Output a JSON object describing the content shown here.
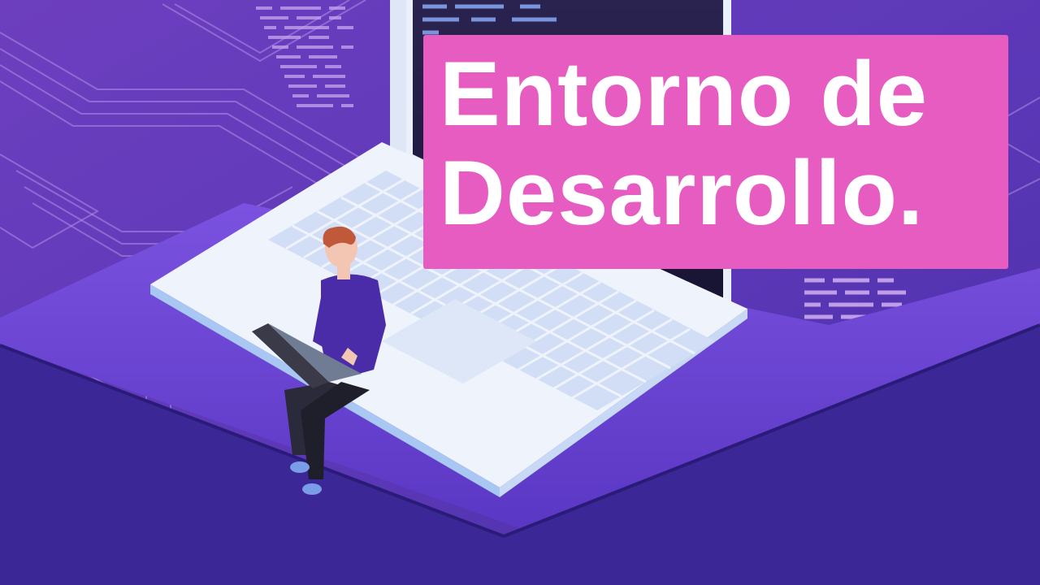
{
  "title": {
    "line1": "Entorno de",
    "line2": "Desarrollo."
  },
  "colors": {
    "background": "#5a36b4",
    "title_box": "#e65cc1",
    "title_text": "#ffffff",
    "laptop_body": "#e9f0fb",
    "shirt": "#4b2ca8",
    "hair": "#c0583a"
  },
  "illustration": {
    "subject": "person-with-laptop-on-giant-laptop",
    "icons": [
      "laptop-icon",
      "person-icon",
      "code-lines-icon",
      "circuit-lines-icon"
    ]
  }
}
